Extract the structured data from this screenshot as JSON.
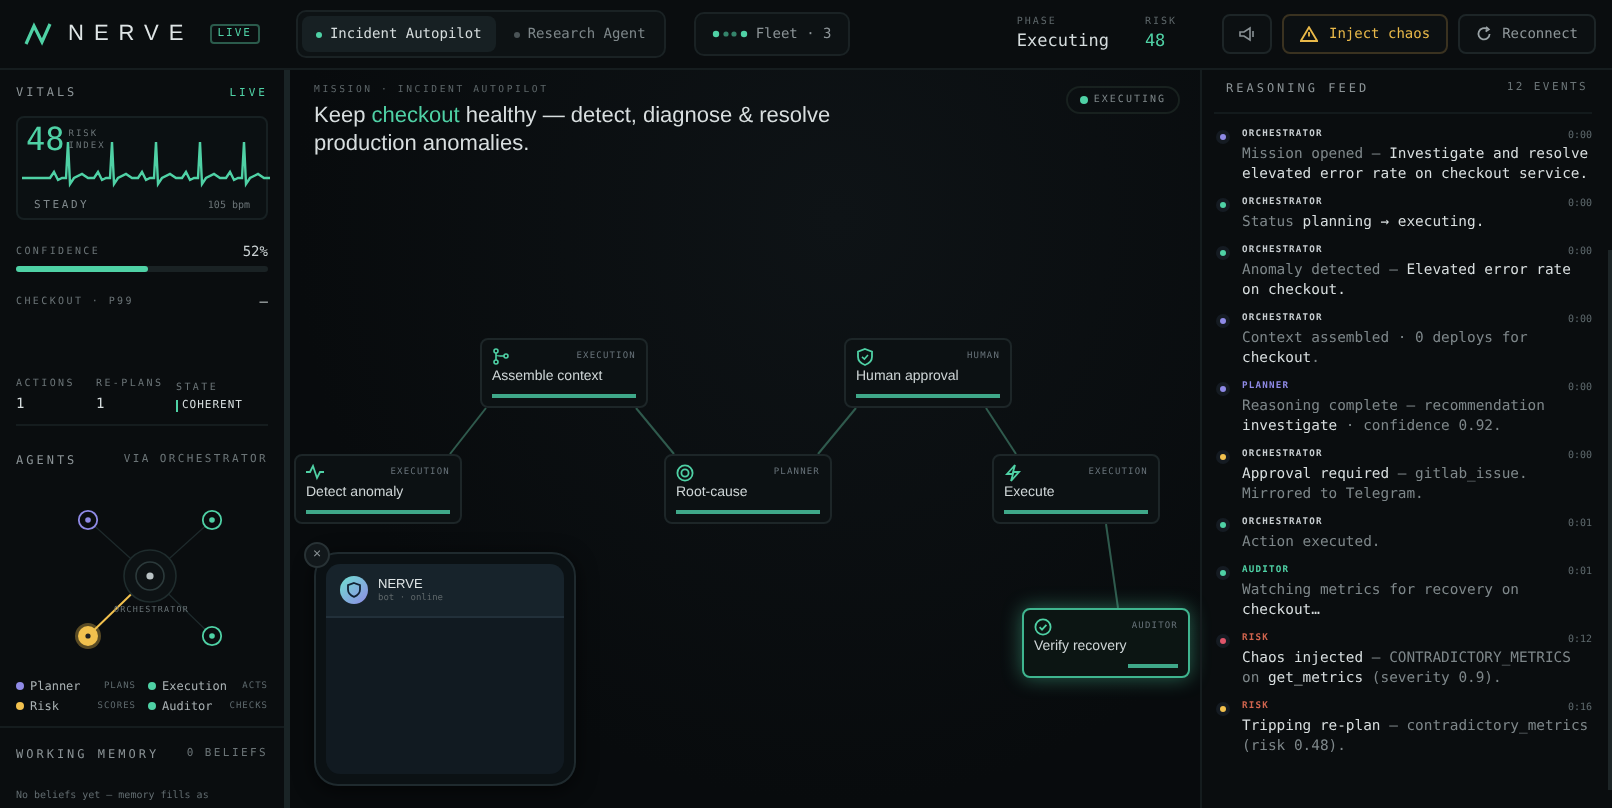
{
  "brand": {
    "name": "NERVE",
    "badge": "LIVE"
  },
  "mode_tabs": [
    {
      "label": "Incident Autopilot",
      "selected": true
    },
    {
      "label": "Research Agent",
      "selected": false
    }
  ],
  "fleet": {
    "label": "Fleet · 3"
  },
  "phase": {
    "label": "PHASE",
    "value": "Executing"
  },
  "risk": {
    "label": "RISK",
    "value": "48"
  },
  "toolbar": [
    {
      "kind": "sound"
    },
    {
      "kind": "warning",
      "label": "Inject chaos"
    },
    {
      "kind": "reconnect",
      "label": "Reconnect"
    }
  ],
  "vitals": {
    "title": "VITALS",
    "live": "LIVE",
    "risk_value": "48",
    "risk_label": "RISK INDEX",
    "status": "STEADY",
    "rate": "105 bpm"
  },
  "confidence": {
    "label": "CONFIDENCE",
    "value": "52%",
    "level": 0.52
  },
  "checkout": {
    "label": "CHECKOUT · P99",
    "value": "—"
  },
  "stats": [
    {
      "kind": "plain",
      "label": "ACTIONS",
      "value": "1"
    },
    {
      "kind": "plain",
      "label": "RE-PLANS",
      "value": "1"
    },
    {
      "kind": "state",
      "label": "STATE",
      "value": "COHERENT"
    }
  ],
  "agents": {
    "title": "AGENTS",
    "subtitle": "VIA ORCHESTRATOR",
    "hub": "ORCHESTRATOR",
    "items": [
      {
        "name": "Planner",
        "role": "PLANS",
        "color": "#8f8ae6",
        "active": false
      },
      {
        "name": "Execution",
        "role": "ACTS",
        "color": "#4fd1a5",
        "active": false
      },
      {
        "name": "Risk",
        "role": "SCORES",
        "color": "#f2c14e",
        "active": true
      },
      {
        "name": "Auditor",
        "role": "CHECKS",
        "color": "#4fd1a5",
        "active": false
      }
    ]
  },
  "memory": {
    "title": "WORKING MEMORY",
    "count": "0 BELIEFS",
    "empty": "No beliefs yet — memory fills as"
  },
  "mission": {
    "label": "MISSION · INCIDENT AUTOPILOT",
    "headline": "Keep **checkout** healthy — detect, diagnose & resolve production anomalies.",
    "status": "EXECUTING"
  },
  "nodes": [
    {
      "kind": "pulse",
      "title": "Detect anomaly",
      "role": "EXECUTION",
      "level": 1,
      "active": false
    },
    {
      "kind": "branch",
      "title": "Assemble context",
      "role": "EXECUTION",
      "level": 1,
      "active": false
    },
    {
      "kind": "target",
      "title": "Root-cause",
      "role": "PLANNER",
      "level": 1,
      "active": false
    },
    {
      "kind": "shield",
      "title": "Human approval",
      "role": "HUMAN",
      "level": 1,
      "active": false
    },
    {
      "kind": "bolt",
      "title": "Execute",
      "role": "EXECUTION",
      "level": 1,
      "active": false
    },
    {
      "kind": "check",
      "title": "Verify recovery",
      "role": "AUDITOR",
      "level": 0.35,
      "active": true
    }
  ],
  "chat": {
    "close": "×",
    "name": "NERVE",
    "status": "bot · online"
  },
  "feed": {
    "title": "REASONING FEED",
    "count": "12 EVENTS",
    "events": [
      {
        "kind": "orchestrator",
        "agent": "ORCHESTRATOR",
        "time": "0:00",
        "color": "#8f8ae6",
        "text": "Mission opened — **Investigate and resolve elevated error rate on checkout service.**"
      },
      {
        "kind": "orchestrator",
        "agent": "ORCHESTRATOR",
        "time": "0:00",
        "color": "#4fd1a5",
        "text": "Status **planning → executing.**"
      },
      {
        "kind": "orchestrator",
        "agent": "ORCHESTRATOR",
        "time": "0:00",
        "color": "#4fd1a5",
        "text": "Anomaly detected — **Elevated error rate on checkout.**"
      },
      {
        "kind": "orchestrator",
        "agent": "ORCHESTRATOR",
        "time": "0:00",
        "color": "#8f8ae6",
        "text": "Context assembled · 0 deploys for **checkout**."
      },
      {
        "kind": "planner",
        "agent": "PLANNER",
        "time": "0:00",
        "color": "#8f8ae6",
        "text": "Reasoning complete — recommendation **investigate** · confidence 0.92."
      },
      {
        "kind": "orchestrator",
        "agent": "ORCHESTRATOR",
        "time": "0:00",
        "color": "#f2c14e",
        "text": "**Approval required** — gitlab_issue. Mirrored to Telegram."
      },
      {
        "kind": "orchestrator",
        "agent": "ORCHESTRATOR",
        "time": "0:01",
        "color": "#4fd1a5",
        "text": "Action executed."
      },
      {
        "kind": "auditor",
        "agent": "AUDITOR",
        "time": "0:01",
        "color": "#4fd1a5",
        "text": "Watching metrics for recovery on **checkout…**"
      },
      {
        "kind": "risk",
        "agent": "RISK",
        "time": "0:12",
        "color": "#e0556a",
        "text": "**Chaos injected** — CONTRADICTORY_METRICS on **get_metrics** (severity 0.9)."
      },
      {
        "kind": "risk",
        "agent": "RISK",
        "time": "0:16",
        "color": "#f2c14e",
        "text": "**Tripping re-plan** — contradictory_metrics (risk 0.48)."
      }
    ]
  }
}
